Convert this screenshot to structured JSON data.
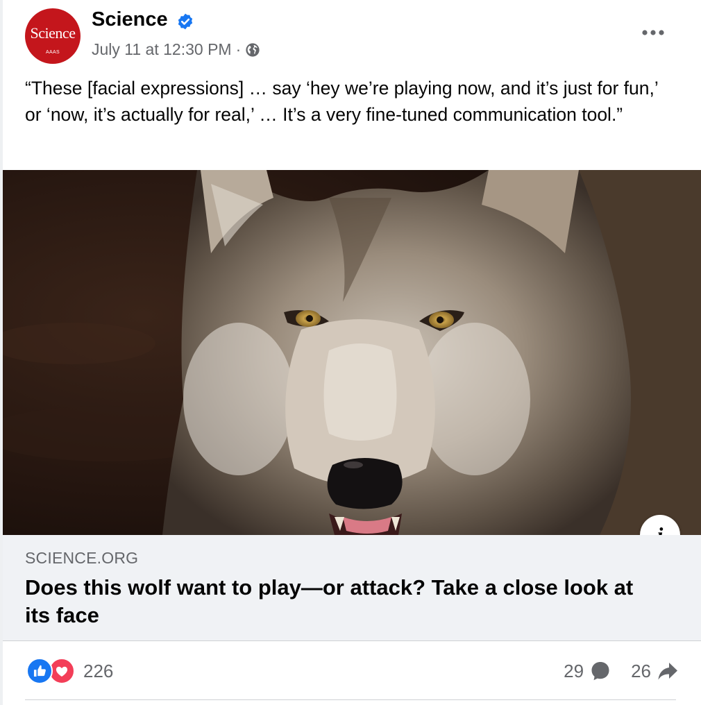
{
  "post": {
    "page_name": "Science",
    "avatar": {
      "logo_text": "Science",
      "sub_text": "AAAS",
      "color": "#c4161c"
    },
    "timestamp": "July 11 at 12:30 PM",
    "separator": "·",
    "privacy_icon": "globe-icon",
    "more_icon": "more-options-icon",
    "caption": "“These [facial expressions] … say ‘hey we’re playing now, and it’s just for fun,’ or ‘now, it’s actually for real,’ … It’s a very fine-tuned communication tool.”"
  },
  "link_preview": {
    "image_description": "wolf-close-up",
    "info_label": "i",
    "domain": "SCIENCE.ORG",
    "headline": "Does this wolf want to play—or attack? Take a close look at its face"
  },
  "engagement": {
    "reaction_icons": [
      "like-icon",
      "love-icon"
    ],
    "reaction_count": "226",
    "comment_count": "29",
    "share_count": "26"
  },
  "colors": {
    "brand_blue": "#1877f2",
    "love_red": "#f33e58",
    "secondary_text": "#65676b",
    "card_background": "#f0f2f5"
  }
}
